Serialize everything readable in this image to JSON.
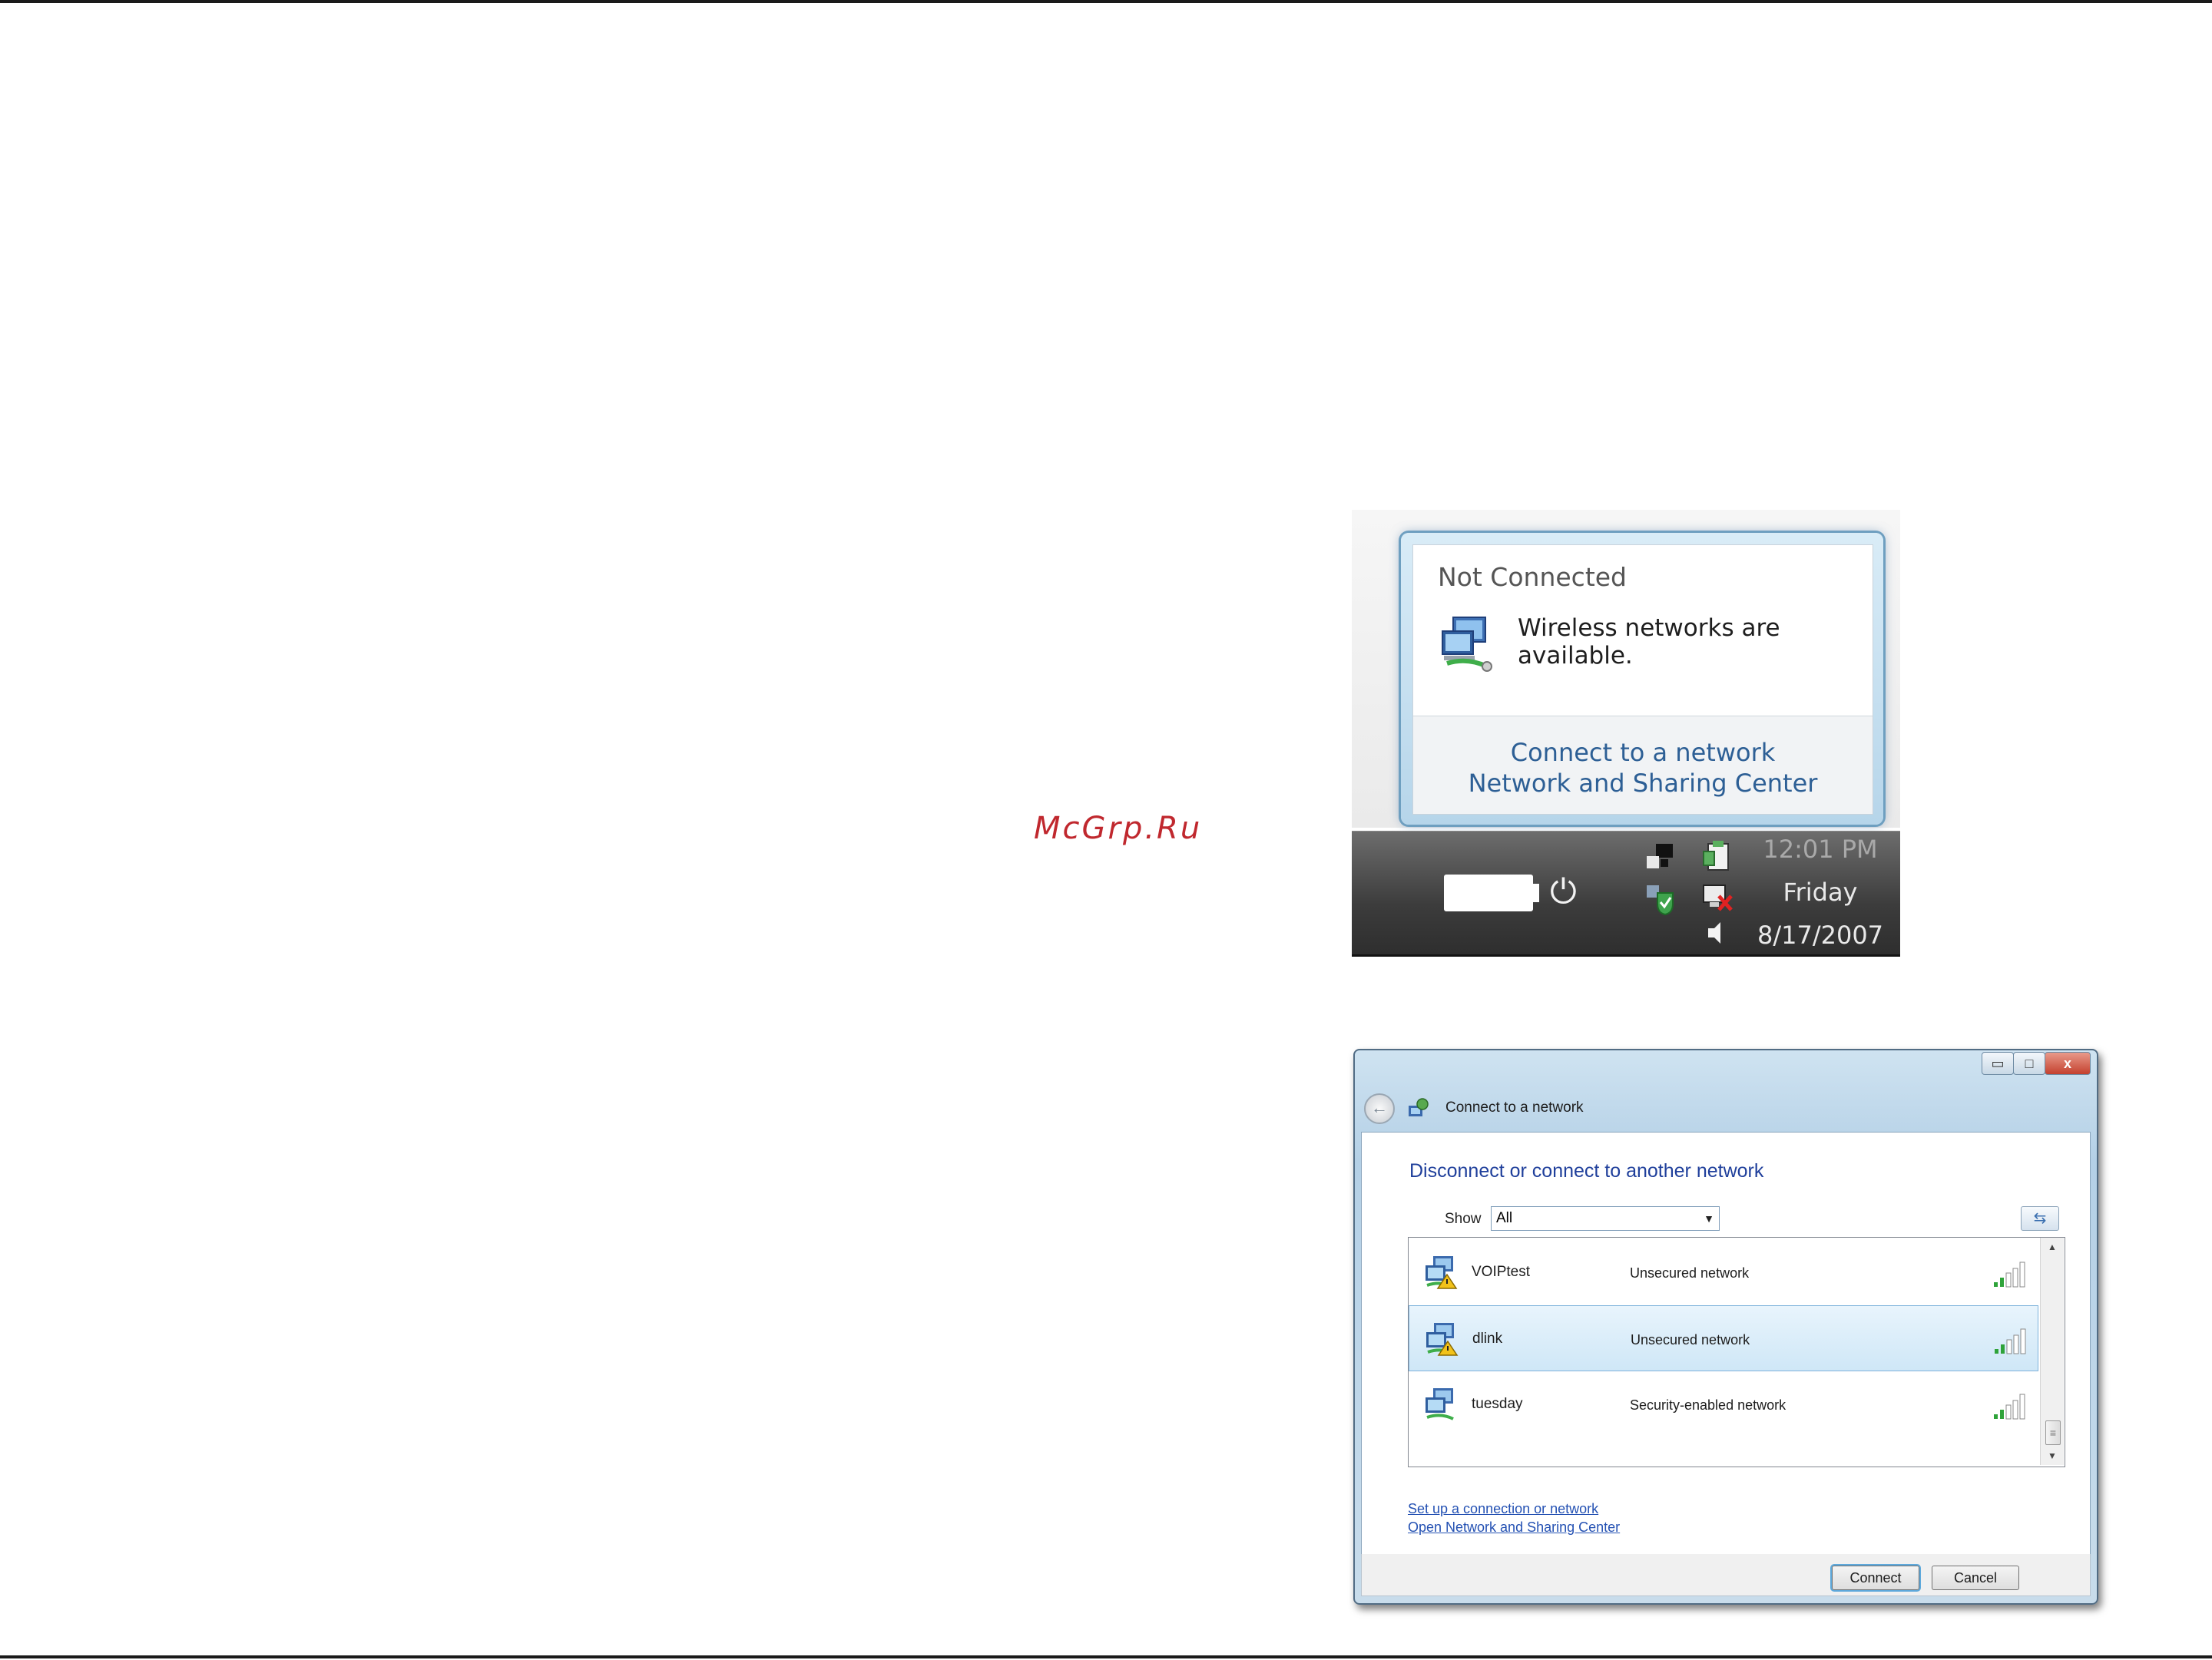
{
  "watermark": "McGrp.Ru",
  "popup": {
    "title": "Not Connected",
    "message": "Wireless networks are available.",
    "link_connect": "Connect to a network",
    "link_center": "Network and Sharing Center",
    "icon": "network-warning-icon"
  },
  "taskbar": {
    "time": "12:01 PM",
    "day": "Friday",
    "date": "8/17/2007",
    "icons": [
      "battery-icon",
      "power-plug-icon",
      "network-icon",
      "security-shield-icon",
      "clipboard-icon",
      "network-disconnected-icon",
      "speaker-icon"
    ]
  },
  "window": {
    "title": "Connect to a network",
    "heading": "Disconnect or connect to another network",
    "show_label": "Show",
    "show_value": "All",
    "networks": [
      {
        "name": "VOIPtest",
        "security": "Unsecured network",
        "selected": false,
        "warning": true
      },
      {
        "name": "dlink",
        "security": "Unsecured network",
        "selected": true,
        "warning": true
      },
      {
        "name": "tuesday",
        "security": "Security-enabled network",
        "selected": false,
        "warning": false
      }
    ],
    "link_setup": "Set up a connection or network",
    "link_center": "Open Network and Sharing Center",
    "connect_label": "Connect",
    "cancel_label": "Cancel",
    "controls": {
      "minimize": "▭",
      "maximize": "□",
      "close": "x"
    }
  },
  "colors": {
    "link_blue": "#2d5f95",
    "heading_blue": "#1f3f9b",
    "watermark_red": "#c0282e",
    "selected_row": "#cfe7f7",
    "signal_green": "#2fa33a"
  }
}
